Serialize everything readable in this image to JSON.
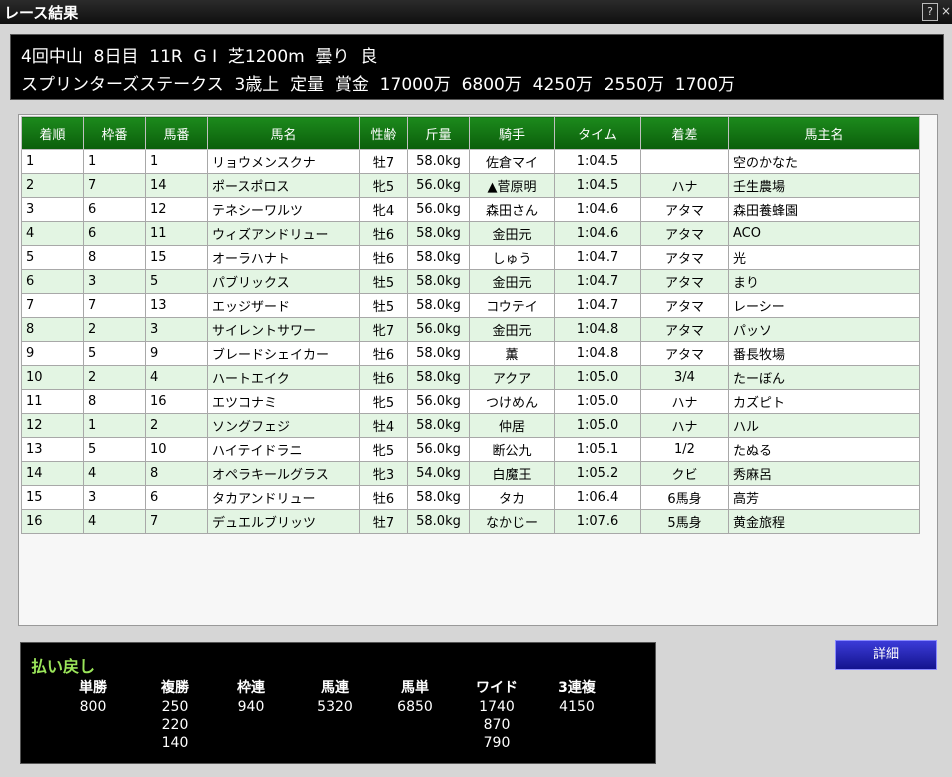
{
  "window": {
    "title": "レース結果",
    "help_label": "?",
    "close_label": "×"
  },
  "race": {
    "line1": "4回中山  8日目  11R  G I  芝1200m  曇り  良",
    "line2": "スプリンターズステークス  3歳上  定量  賞金  17000万  6800万  4250万  2550万  1700万"
  },
  "table": {
    "headers": [
      "着順",
      "枠番",
      "馬番",
      "馬名",
      "性齢",
      "斤量",
      "騎手",
      "タイム",
      "着差",
      "馬主名"
    ],
    "rows": [
      [
        "1",
        "1",
        "1",
        "リョウメンスクナ",
        "牡7",
        "58.0kg",
        "佐倉マイ",
        "1:04.5",
        "",
        "空のかなた"
      ],
      [
        "2",
        "7",
        "14",
        "ポースポロス",
        "牝5",
        "56.0kg",
        "▲菅原明",
        "1:04.5",
        "ハナ",
        "壬生農場"
      ],
      [
        "3",
        "6",
        "12",
        "テネシーワルツ",
        "牝4",
        "56.0kg",
        "森田さん",
        "1:04.6",
        "アタマ",
        "森田養蜂園"
      ],
      [
        "4",
        "6",
        "11",
        "ウィズアンドリュー",
        "牡6",
        "58.0kg",
        "金田元",
        "1:04.6",
        "アタマ",
        "ACO"
      ],
      [
        "5",
        "8",
        "15",
        "オーラハナト",
        "牡6",
        "58.0kg",
        "しゅう",
        "1:04.7",
        "アタマ",
        "光"
      ],
      [
        "6",
        "3",
        "5",
        "パブリックス",
        "牡5",
        "58.0kg",
        "金田元",
        "1:04.7",
        "アタマ",
        "まり"
      ],
      [
        "7",
        "7",
        "13",
        "エッジザード",
        "牡5",
        "58.0kg",
        "コウテイ",
        "1:04.7",
        "アタマ",
        "レーシー"
      ],
      [
        "8",
        "2",
        "3",
        "サイレントサワー",
        "牝7",
        "56.0kg",
        "金田元",
        "1:04.8",
        "アタマ",
        "パッソ"
      ],
      [
        "9",
        "5",
        "9",
        "ブレードシェイカー",
        "牡6",
        "58.0kg",
        "薫",
        "1:04.8",
        "アタマ",
        "番長牧場"
      ],
      [
        "10",
        "2",
        "4",
        "ハートエイク",
        "牡6",
        "58.0kg",
        "アクア",
        "1:05.0",
        "3/4",
        "たーぼん"
      ],
      [
        "11",
        "8",
        "16",
        "エツコナミ",
        "牝5",
        "56.0kg",
        "つけめん",
        "1:05.0",
        "ハナ",
        "カズピト"
      ],
      [
        "12",
        "1",
        "2",
        "ソングフェジ",
        "牡4",
        "58.0kg",
        "仲居",
        "1:05.0",
        "ハナ",
        "ハル"
      ],
      [
        "13",
        "5",
        "10",
        "ハイテイドラニ",
        "牝5",
        "56.0kg",
        "断公九",
        "1:05.1",
        "1/2",
        "たぬる"
      ],
      [
        "14",
        "4",
        "8",
        "オペラキールグラス",
        "牝3",
        "54.0kg",
        "白魔王",
        "1:05.2",
        "クビ",
        "秀麻呂"
      ],
      [
        "15",
        "3",
        "6",
        "タカアンドリュー",
        "牡6",
        "58.0kg",
        "タカ",
        "1:06.4",
        "6馬身",
        "高芳"
      ],
      [
        "16",
        "4",
        "7",
        "デュエルブリッツ",
        "牡7",
        "58.0kg",
        "なかじー",
        "1:07.6",
        "5馬身",
        "黄金旅程"
      ]
    ]
  },
  "payout": {
    "title": "払い戻し",
    "columns": [
      {
        "label": "単勝",
        "values": [
          "800"
        ]
      },
      {
        "label": "複勝",
        "values": [
          "250",
          "220",
          "140"
        ]
      },
      {
        "label": "枠連",
        "values": [
          "940"
        ]
      },
      {
        "label": "馬連",
        "values": [
          "5320"
        ]
      },
      {
        "label": "馬単",
        "values": [
          "6850"
        ]
      },
      {
        "label": "ワイド",
        "values": [
          "1740",
          "870",
          "790"
        ]
      },
      {
        "label": "3連複",
        "values": [
          "4150"
        ]
      }
    ]
  },
  "detail_button": {
    "label": "詳細"
  }
}
